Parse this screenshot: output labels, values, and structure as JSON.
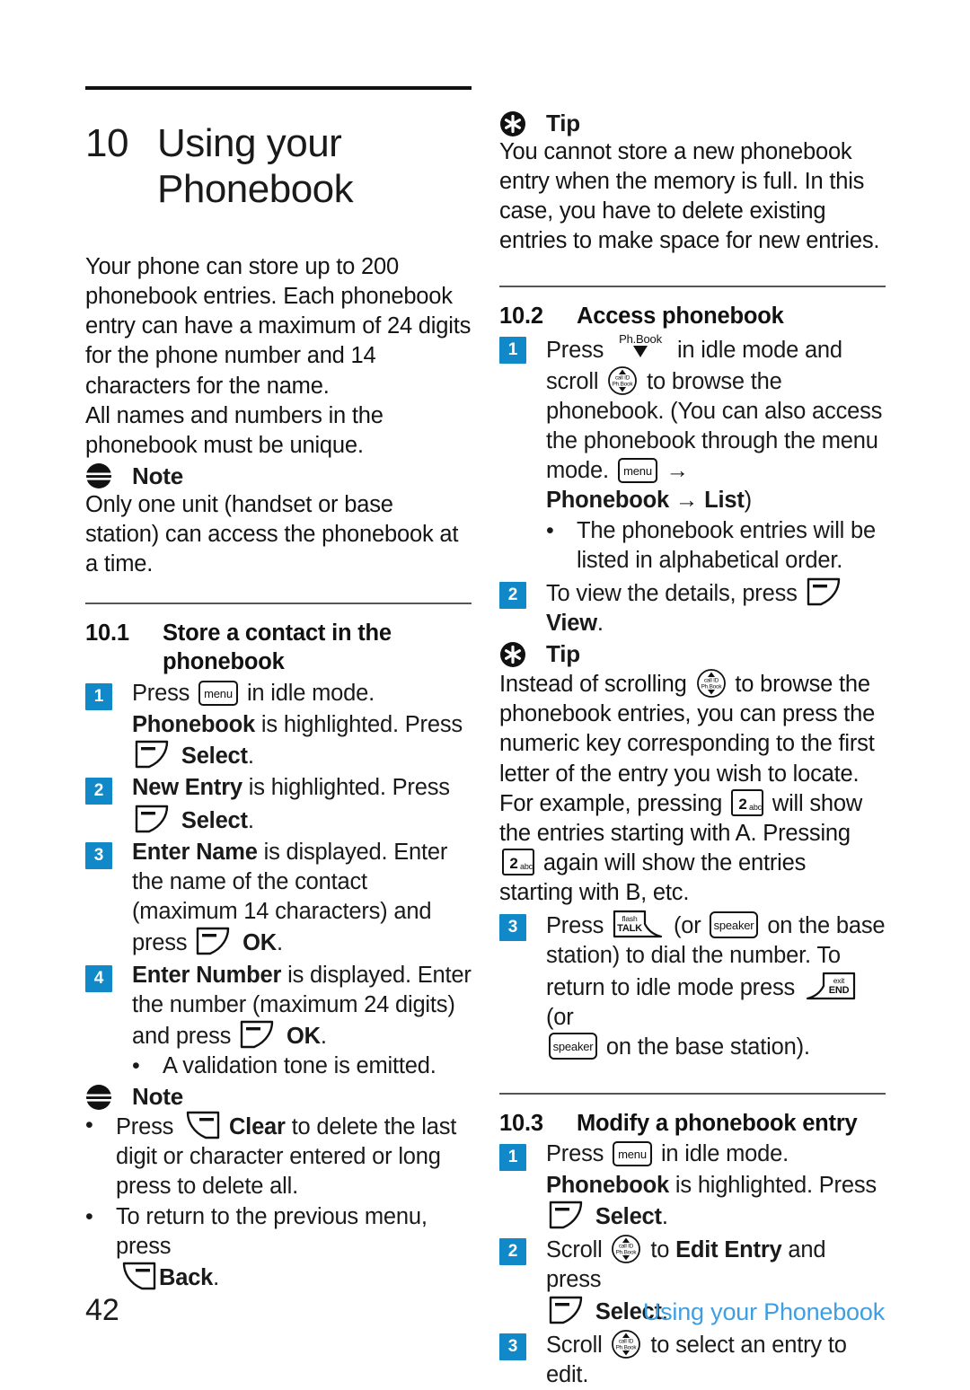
{
  "colors": {
    "accent_blue": "#1189c8",
    "running_head_blue": "#3f9ee0",
    "text": "#141414"
  },
  "chapter": {
    "number": "10",
    "title_line1": "Using your",
    "title_line2": "Phonebook"
  },
  "intro": {
    "p1": "Your phone can store up to 200 phonebook entries. Each phonebook entry can have a maximum of 24 digits for the phone number and 14 characters for the name.",
    "p2": "All names and numbers in the phonebook must be unique."
  },
  "note1": {
    "icon": "note-icon",
    "label": "Note",
    "text": "Only one unit (handset or base station) can access the phonebook at a time."
  },
  "section_10_1": {
    "number": "10.1",
    "title": "Store a contact in the phonebook",
    "steps": [
      {
        "badge": "1",
        "pre": "Press",
        "icon": "menu-key-icon",
        "post": "in idle mode.",
        "cont_bold1": "Phonebook",
        "cont_rest1": " is highlighted. Press",
        "cont_icon": "left-softkey-icon",
        "cont_bold2": "Select",
        "cont_rest2": "."
      },
      {
        "badge": "2",
        "pre_bold": "New Entry",
        "pre_rest": " is highlighted. Press",
        "cont_icon": "left-softkey-icon",
        "cont_bold": "Select",
        "cont_rest": "."
      },
      {
        "badge": "3",
        "pre_bold": "Enter Name",
        "pre_rest": " is displayed. Enter the name of the contact (maximum 14 characters) and press",
        "icon": "left-softkey-icon",
        "post_bold": "OK",
        "post_rest": "."
      },
      {
        "badge": "4",
        "pre_bold": "Enter Number",
        "pre_rest": " is displayed. Enter the number (maximum 24 digits) and press",
        "icon": "left-softkey-icon",
        "post_bold": "OK",
        "post_rest": "."
      }
    ],
    "sub_bullet": "A validation tone is emitted."
  },
  "note2": {
    "icon": "note-icon",
    "label": "Note",
    "bullet1_pre": "Press",
    "bullet1_icon": "right-softkey-icon",
    "bullet1_bold": "Clear",
    "bullet1_rest": " to delete the last digit or character entered or long press to delete all.",
    "bullet2_pre": "To return to the previous menu, press",
    "bullet2_icon": "right-softkey-icon",
    "bullet2_bold": "Back",
    "bullet2_rest": "."
  },
  "tip1": {
    "icon": "tip-icon",
    "label": "Tip",
    "text": "You cannot store a new phonebook entry when the memory is full. In this case, you have to delete existing entries to make space for new entries."
  },
  "section_10_2": {
    "number": "10.2",
    "title": "Access phonebook",
    "step1": {
      "badge": "1",
      "pre": "Press",
      "icon1": "phonebook-down-key-icon",
      "mid1": "in idle mode and scroll",
      "icon2": "navigation-key-icon",
      "mid2": "to browse the phonebook. (You can also access the phonebook through the menu mode.",
      "icon3": "menu-key-icon",
      "arrow": "→",
      "path_bold1": "Phonebook",
      "path_arrow": "→",
      "path_bold2": "List",
      "path_close": ")"
    },
    "bullet1": "The phonebook entries will be listed in alphabetical order.",
    "step2": {
      "badge": "2",
      "pre": "To view the details, press",
      "icon": "left-softkey-icon",
      "post_bold": "View",
      "post_rest": "."
    }
  },
  "tip2": {
    "icon": "tip-icon",
    "label": "Tip",
    "pre": "Instead of scrolling",
    "icon_nav": "navigation-key-icon",
    "mid": "to browse the phonebook entries, you can press the numeric key corresponding to the first letter of the entry you wish to locate. For example, pressing",
    "icon_key2a": "key-2abc-icon",
    "mid2": "will show the entries starting with A. Pressing",
    "icon_key2b": "key-2abc-icon",
    "tail": "again will show the entries starting with B, etc."
  },
  "section_10_2_step3": {
    "badge": "3",
    "pre": "Press",
    "icon_talk": "talk-key-icon",
    "mid1": "(or",
    "icon_speaker1": "speaker-key-icon",
    "mid2": "on the base station) to dial the number. To return to idle mode press",
    "icon_end": "end-key-icon",
    "mid3": "(or",
    "icon_speaker2": "speaker-key-icon",
    "tail": "on the base station)."
  },
  "section_10_3": {
    "number": "10.3",
    "title": "Modify a phonebook entry",
    "steps": [
      {
        "badge": "1",
        "pre": "Press",
        "icon": "menu-key-icon",
        "post": "in idle mode.",
        "cont_bold1": "Phonebook",
        "cont_rest1": " is highlighted. Press",
        "cont_icon": "left-softkey-icon",
        "cont_bold2": "Select",
        "cont_rest2": "."
      },
      {
        "badge": "2",
        "pre": "Scroll",
        "icon": "navigation-key-icon",
        "mid": "to",
        "bold": "Edit Entry",
        "post": " and press",
        "cont_icon": "left-softkey-icon",
        "cont_bold": "Select",
        "cont_rest": "."
      },
      {
        "badge": "3",
        "pre": "Scroll",
        "icon": "navigation-key-icon",
        "post": "to select an entry to edit."
      }
    ]
  },
  "footer": {
    "page_number": "42",
    "running_head": "Using your Phonebook"
  },
  "key_labels": {
    "menu": "menu",
    "speaker": "speaker",
    "talk_top": "flash",
    "talk_bottom": "TALK",
    "end_top": "exit",
    "end_bottom": "END",
    "phonebook_key": "Ph.Book",
    "nav_top": "call ID",
    "nav_bottom": "Ph.Book",
    "key2_digit": "2",
    "key2_letters": "abc"
  }
}
